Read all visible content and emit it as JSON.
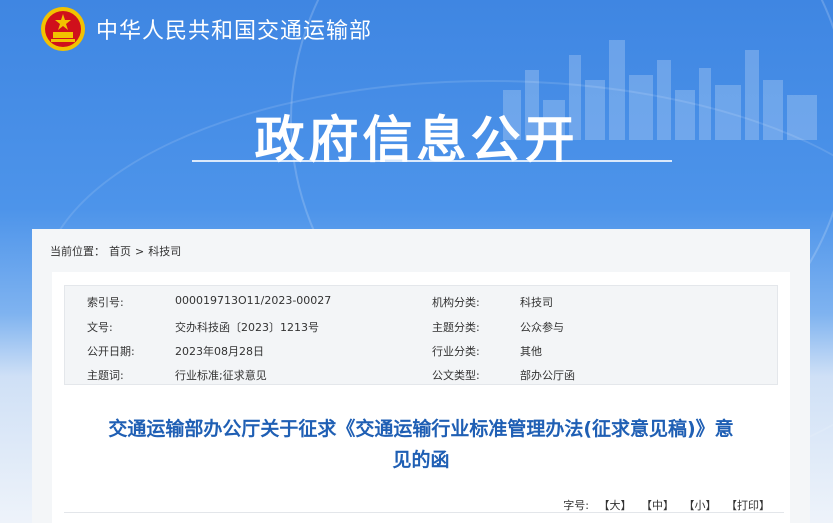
{
  "header": {
    "site_name": "中华人民共和国交通运输部",
    "banner_title": "政府信息公开"
  },
  "breadcrumb": {
    "prefix": "当前位置：",
    "home": "首页",
    "sep": ">",
    "current": "科技司"
  },
  "meta": {
    "index_no_label": "索引号:",
    "index_no_value": "000019713O11/2023-00027",
    "doc_no_label": "文号:",
    "doc_no_value": "交办科技函〔2023〕1213号",
    "publish_date_label": "公开日期:",
    "publish_date_value": "2023年08月28日",
    "keywords_label": "主题词:",
    "keywords_value": "行业标准;征求意见",
    "org_label": "机构分类:",
    "org_value": "科技司",
    "topic_label": "主题分类:",
    "topic_value": "公众参与",
    "industry_label": "行业分类:",
    "industry_value": "其他",
    "doc_type_label": "公文类型:",
    "doc_type_value": "部办公厅函"
  },
  "document": {
    "title_line1": "交通运输部办公厅关于征求《交通运输行业标准管理办法(征求意见稿)》意",
    "title_line2": "见的函"
  },
  "font_size": {
    "label": "字号:",
    "large": "【大】",
    "medium": "【中】",
    "small": "【小】",
    "print": "【打印】"
  },
  "colors": {
    "banner_blue": "#3f86e2",
    "title_blue": "#1f5fb4",
    "emblem_red": "#d0101b",
    "emblem_gold": "#f2c200"
  }
}
